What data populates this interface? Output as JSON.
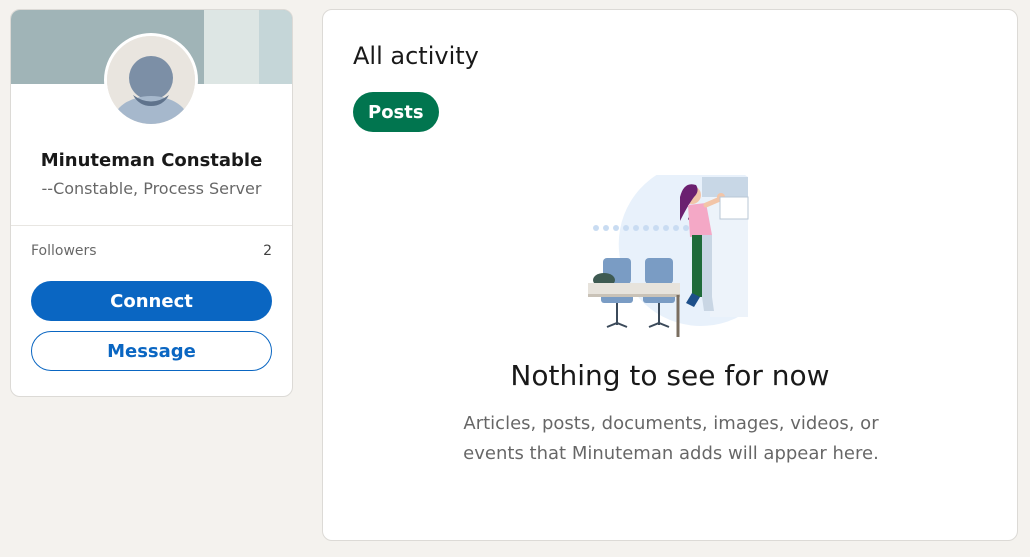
{
  "profile": {
    "name": "Minuteman Constable",
    "headline": "--Constable, Process Server",
    "followers_label": "Followers",
    "followers_count": "2",
    "connect_label": "Connect",
    "message_label": "Message"
  },
  "activity": {
    "title": "All activity",
    "filter_pill": "Posts",
    "empty_title": "Nothing to see for now",
    "empty_description": "Articles, posts, documents, images, videos, or events that Minuteman adds will appear here."
  },
  "colors": {
    "brand_blue": "#0a66c2",
    "pill_green": "#01754f",
    "page_background": "#f4f2ee"
  }
}
